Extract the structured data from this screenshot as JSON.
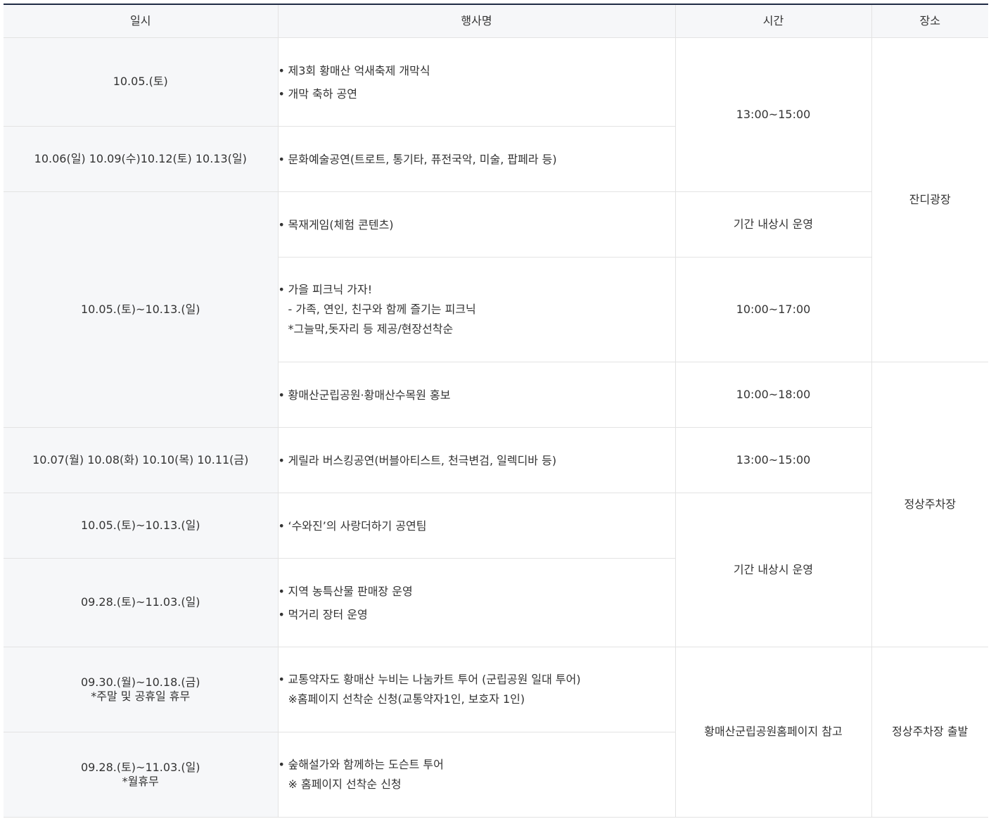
{
  "headers": {
    "date": "일시",
    "event": "행사명",
    "time": "시간",
    "place": "장소"
  },
  "rows": [
    {
      "date": "10.05.(토)",
      "events": [
        "제3회 황매산 억새축제 개막식",
        "개막 축하 공연"
      ]
    },
    {
      "date": "10.06(일) 10.09(수)10.12(토) 10.13(일)",
      "events": [
        "문화예술공연(트로트, 통기타, 퓨전국악, 미술, 팝페라 등)"
      ]
    },
    {
      "events": [
        "목재게임(체험 콘텐츠)"
      ],
      "time": "기간 내상시 운영"
    },
    {
      "events": [
        "가을 피크닉 가자!"
      ],
      "sub": [
        "- 가족, 연인, 친구와 함께 즐기는 피크닉",
        "*그늘막,돗자리 등 제공/현장선착순"
      ],
      "time": "10:00~17:00"
    },
    {
      "events": [
        "황매산군립공원·황매산수목원 홍보"
      ],
      "time": "10:00~18:00"
    },
    {
      "date": "10.07(월) 10.08(화) 10.10(목) 10.11(금)",
      "events": [
        "게릴라 버스킹공연(버블아티스트, 천극변검, 일렉디바 등)"
      ],
      "time": "13:00~15:00"
    },
    {
      "date": "10.05.(토)~10.13.(일)",
      "events": [
        "‘수와진’의 사랑더하기 공연팀"
      ]
    },
    {
      "date": "09.28.(토)~11.03.(일)",
      "events": [
        "지역 농특산물 판매장 운영",
        "먹거리 장터 운영"
      ]
    },
    {
      "date": "09.30.(월)~10.18.(금)",
      "date_note": "*주말 및 공휴일 휴무",
      "events": [
        "교통약자도 황매산 누비는 나눔카트 투어 (군립공원 일대 투어)"
      ],
      "sub": [
        "※홈페이지 선착순 신청(교통약자1인, 보호자 1인)"
      ]
    },
    {
      "date": "09.28.(토)~11.03.(일)",
      "date_note": "*월휴무",
      "events": [
        "숲해설가와 함께하는 도슨트 투어"
      ],
      "sub": [
        "※ 홈페이지 선착순 신청"
      ]
    }
  ],
  "merged": {
    "date_festival": "10.05.(토)~10.13.(일)",
    "time_opening": "13:00~15:00",
    "time_always": "기간 내상시 운영",
    "time_homepage": "황매산군립공원홈페이지 참고",
    "place_grass": "잔디광장",
    "place_parking": "정상주차장",
    "place_parking_depart": "정상주차장 출발"
  }
}
